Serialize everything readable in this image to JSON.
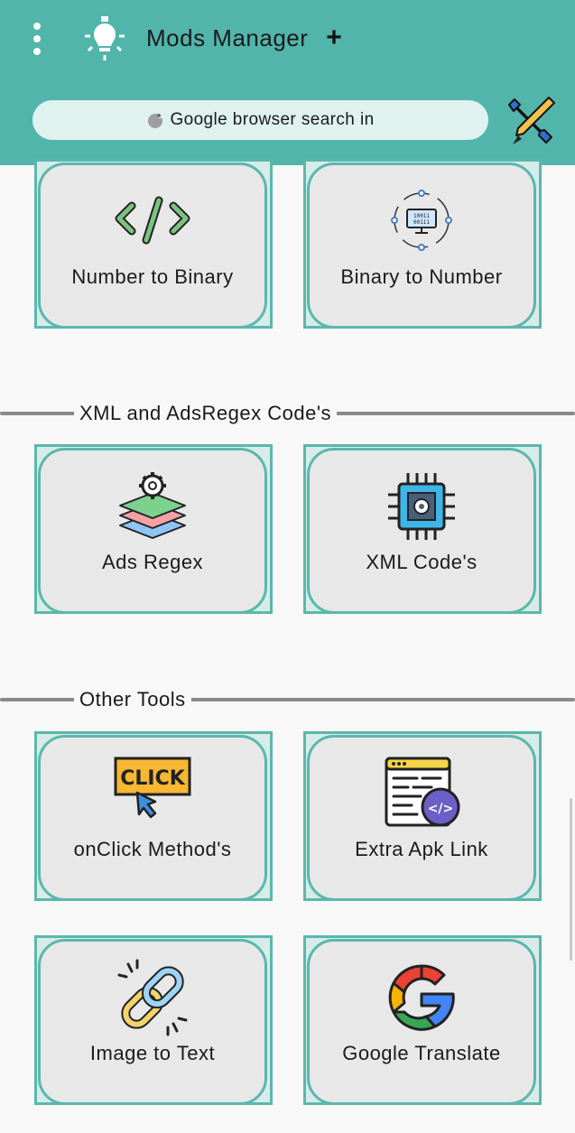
{
  "header": {
    "menu_icon": "more-vert-icon",
    "logo_icon": "lightbulb-icon",
    "title": "Mods Manager",
    "add_icon": "plus-icon",
    "search_placeholder": "Google browser search in",
    "search_icon": "search-icon",
    "tools_icon": "tools-icon"
  },
  "sections": [
    {
      "title": "",
      "cards": [
        {
          "label": "Number to Binary",
          "icon": "code-icon"
        },
        {
          "label": "Binary to Number",
          "icon": "binary-computer-icon"
        }
      ]
    },
    {
      "title": "XML and AdsRegex Code's",
      "cards": [
        {
          "label": "Ads Regex",
          "icon": "layers-gear-icon"
        },
        {
          "label": "XML Code's",
          "icon": "cpu-chip-icon"
        }
      ]
    },
    {
      "title": "Other Tools",
      "cards": [
        {
          "label": "onClick Method's",
          "icon": "click-icon",
          "icon_text": "CLICK"
        },
        {
          "label": "Extra Apk Link",
          "icon": "web-code-icon"
        },
        {
          "label": "Image to Text",
          "icon": "link-icon"
        },
        {
          "label": "Google Translate",
          "icon": "google-icon"
        }
      ]
    }
  ],
  "colors": {
    "header": "#52b5ab",
    "card_border": "#5bb7ad",
    "card_fill": "#e8e8e8",
    "search_fill": "#dff2f0"
  }
}
